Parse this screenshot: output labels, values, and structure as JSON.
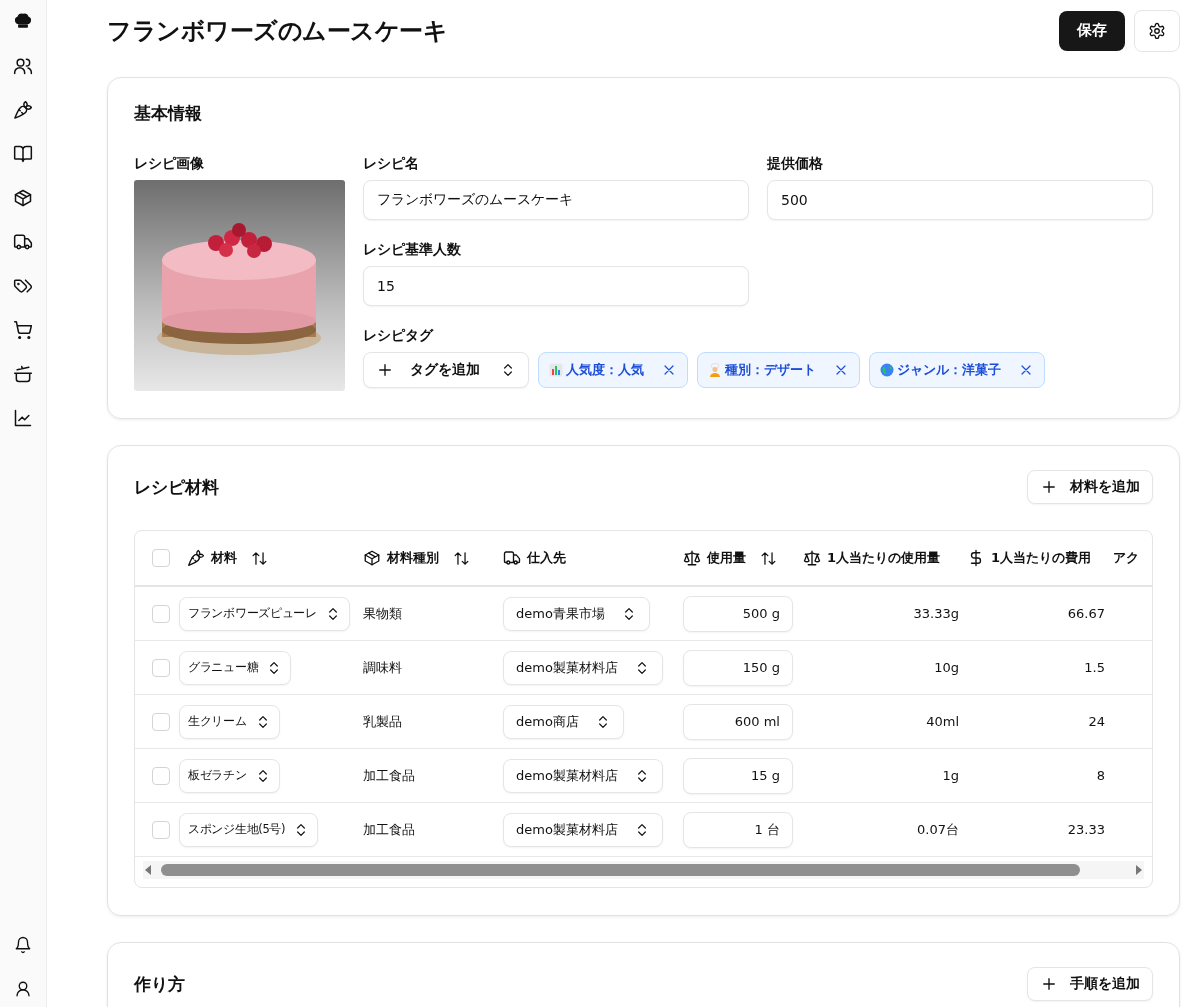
{
  "page": {
    "title": "フランボワーズのムースケーキ",
    "save_button": "保存"
  },
  "basic_info": {
    "title": "基本情報",
    "image_label": "レシピ画像",
    "fields": [
      {
        "label": "レシピ名",
        "value": "フランボワーズのムースケーキ"
      },
      {
        "label": "提供価格",
        "value": "500"
      },
      {
        "label": "レシピ基準人数",
        "value": "15"
      }
    ],
    "tags": {
      "label": "レシピタグ",
      "add_button": "タグを追加",
      "items": [
        {
          "text": "人気度：人気"
        },
        {
          "text": "種別：デザート"
        },
        {
          "text": "ジャンル：洋菓子"
        }
      ]
    }
  },
  "ingredients": {
    "title": "レシピ材料",
    "add_button": "材料を追加",
    "header_checked": false,
    "columns": [
      {
        "label": "材料",
        "sortable": true
      },
      {
        "label": "材料種別",
        "sortable": true
      },
      {
        "label": "仕入先",
        "sortable": false
      },
      {
        "label": "使用量",
        "sortable": true
      },
      {
        "label": "1人当たりの使用量",
        "sortable": false
      },
      {
        "label": "1人当たりの費用",
        "sortable": false
      },
      {
        "label": "アク",
        "sortable": false
      }
    ],
    "rows": [
      {
        "checked": false,
        "material": "フランボワーズピューレ",
        "type": "果物類",
        "supplier": "demo青果市場",
        "amount": "500 g",
        "per_person_amount": "33.33g",
        "per_person_cost": "66.67"
      },
      {
        "checked": false,
        "material": "グラニュー糖",
        "type": "調味料",
        "supplier": "demo製菓材料店",
        "amount": "150 g",
        "per_person_amount": "10g",
        "per_person_cost": "1.5"
      },
      {
        "checked": false,
        "material": "生クリーム",
        "type": "乳製品",
        "supplier": "demo商店",
        "amount": "600 ml",
        "per_person_amount": "40ml",
        "per_person_cost": "24"
      },
      {
        "checked": false,
        "material": "板ゼラチン",
        "type": "加工食品",
        "supplier": "demo製菓材料店",
        "amount": "15 g",
        "per_person_amount": "1g",
        "per_person_cost": "8"
      },
      {
        "checked": false,
        "material": "スポンジ生地(5号)",
        "type": "加工食品",
        "supplier": "demo製菓材料店",
        "amount": "1 台",
        "per_person_amount": "0.07台",
        "per_person_cost": "23.33"
      }
    ]
  },
  "steps": {
    "title": "作り方",
    "add_button": "手順を追加"
  }
}
